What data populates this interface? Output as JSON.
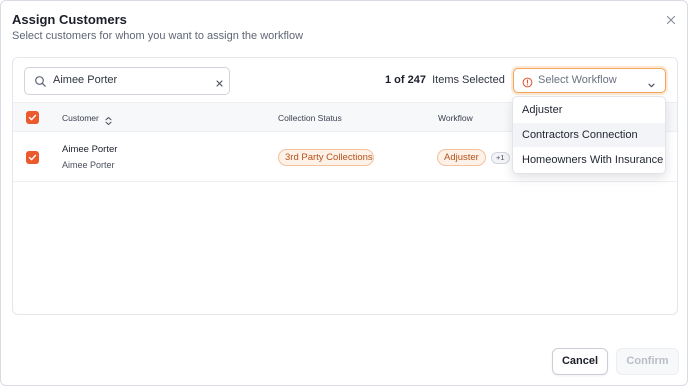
{
  "dialog": {
    "title": "Assign Customers",
    "subtitle": "Select customers for whom you want to assign the workflow"
  },
  "search": {
    "value": "Aimee Porter"
  },
  "selection": {
    "count": "1 of 247",
    "label": "Items Selected"
  },
  "workflow_select": {
    "placeholder": "Select Workflow"
  },
  "table": {
    "headers": {
      "customer": "Customer",
      "collection_status": "Collection Status",
      "workflow": "Workflow"
    },
    "rows": [
      {
        "name": "Aimee Porter",
        "sub": "Aimee Porter",
        "collection_status": "3rd Party Collections",
        "workflow": "Adjuster",
        "workflow_more": "+1",
        "checked": true
      }
    ]
  },
  "dropdown": {
    "options": [
      "Adjuster",
      "Contractors Connection",
      "Homeowners With Insurance"
    ]
  },
  "footer": {
    "cancel_label": "Cancel",
    "confirm_label": "Confirm"
  },
  "colors": {
    "accent": "#ea5a2c",
    "badge_bg": "#fdf1e8",
    "badge_text": "#b5521b",
    "focus_border": "#f2a55b"
  }
}
